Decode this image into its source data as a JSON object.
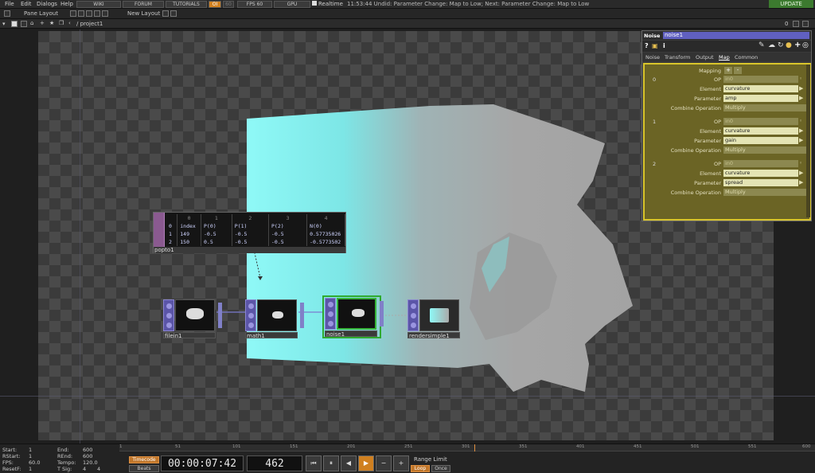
{
  "menu": {
    "items": [
      "File",
      "Edit",
      "Dialogs",
      "Help"
    ],
    "wiki": "WIKI",
    "forum": "FORUM",
    "tutorials": "TUTORIALS",
    "oi": "OI",
    "sixty": "60",
    "fps_label": "FPS",
    "fps_value": "60",
    "gpu": "GPU",
    "realtime": "Realtime",
    "status": "11:53:44 Undid: Parameter Change: Map to Low; Next: Parameter Change: Map to Low",
    "update": "UPDATE"
  },
  "bar2": {
    "pane_layout": "Pane Layout",
    "new_layout": "New Layout"
  },
  "bar3": {
    "path": "/ project1",
    "pane_index": "0"
  },
  "nodes": {
    "filein": "filein1",
    "math": "math1",
    "noise": "noise1",
    "render": "rendersimple1",
    "popto": "popto1"
  },
  "table": {
    "headers": [
      "",
      "0",
      "1",
      "2",
      "3",
      "4"
    ],
    "rows": [
      [
        "0",
        "index",
        "P(0)",
        "P(1)",
        "P(2)",
        "N(0)"
      ],
      [
        "1",
        "149",
        "-0.5",
        "-0.5",
        "-0.5",
        "0.57735026"
      ],
      [
        "2",
        "150",
        "0.5",
        "-0.5",
        "-0.5",
        "-0.5773502"
      ]
    ]
  },
  "panel": {
    "type": "Noise",
    "name": "noise1",
    "tabs": [
      "Noise",
      "Transform",
      "Output",
      "Map",
      "Common"
    ],
    "mapping_label": "Mapping",
    "blocks": [
      {
        "index": "0",
        "op": "in0",
        "element": "curvature",
        "parameter": "amp",
        "combine": "Multiply"
      },
      {
        "index": "1",
        "op": "in0",
        "element": "curvature",
        "parameter": "gain",
        "combine": "Multiply"
      },
      {
        "index": "2",
        "op": "in0",
        "element": "curvature",
        "parameter": "spread",
        "combine": "Multiply"
      }
    ],
    "labels": {
      "op": "OP",
      "element": "Element",
      "parameter": "Parameter",
      "combine": "Combine Operation"
    }
  },
  "timeline": {
    "start_label": "Start:",
    "start": "1",
    "end_label": "End:",
    "end": "600",
    "rstart_label": "RStart:",
    "rstart": "1",
    "rend_label": "REnd:",
    "rend": "600",
    "fps_label": "FPS:",
    "fps": "60.0",
    "tempo_label": "Tempo:",
    "tempo": "120.0",
    "resetf_label": "ResetF:",
    "resetf": "1",
    "tsig_label": "T Sig:",
    "tsig_a": "4",
    "tsig_b": "4",
    "timecode_btn": "Timecode",
    "beats_btn": "Beats",
    "timecode": "00:00:07:42",
    "frame": "462",
    "range_limit": "Range Limit",
    "loop": "Loop",
    "once": "Once",
    "ticks": [
      "1",
      "51",
      "101",
      "151",
      "201",
      "251",
      "301",
      "351",
      "401",
      "451",
      "501",
      "551",
      "600"
    ]
  },
  "colors": {
    "accent_green": "#37b33a",
    "panel_yellow": "#d9c52b",
    "play_orange": "#d08020",
    "node_blue": "#5b55a8"
  }
}
